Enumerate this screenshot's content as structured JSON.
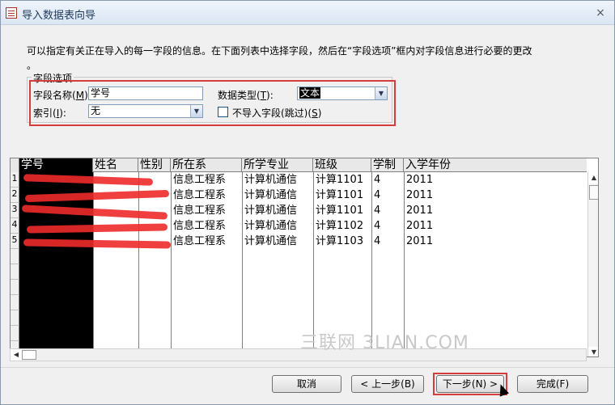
{
  "window": {
    "title": "导入数据表向导",
    "close_glyph": "×"
  },
  "instruction": "可以指定有关正在导入的每一字段的信息。在下面列表中选择字段，然后在“字段选项”框内对字段信息进行必要的更改\n。",
  "field_options": {
    "legend": "字段选项",
    "field_name_label": "字段名称",
    "field_name_key": "M",
    "field_name_value": "学号",
    "data_type_label": "数据类型",
    "data_type_key": "T",
    "data_type_value": "文本",
    "index_label": "索引",
    "index_key": "I",
    "index_value": "无",
    "skip_label": "不导入字段(跳过)",
    "skip_key": "S"
  },
  "table": {
    "columns": [
      "学号",
      "姓名",
      "性别",
      "所在系",
      "所学专业",
      "班级",
      "学制",
      "入学年份"
    ],
    "row_numbers": [
      "1",
      "2",
      "3",
      "4",
      "5"
    ],
    "rows": [
      [
        "",
        "",
        "",
        "信息工程系",
        "计算机通信",
        "计算1101",
        "4",
        "2011"
      ],
      [
        "",
        "",
        "",
        "信息工程系",
        "计算机通信",
        "计算1101",
        "4",
        "2011"
      ],
      [
        "",
        "",
        "",
        "信息工程系",
        "计算机通信",
        "计算1101",
        "4",
        "2011"
      ],
      [
        "",
        "",
        "",
        "信息工程系",
        "计算机通信",
        "计算1102",
        "4",
        "2011"
      ],
      [
        "",
        "",
        "",
        "信息工程系",
        "计算机通信",
        "计算1103",
        "4",
        "2011"
      ]
    ]
  },
  "watermark": "三联网 3LIAN.COM",
  "buttons": {
    "cancel": "取消",
    "back": "< 上一步(B)",
    "next": "下一步(N) >",
    "finish": "完成(F)"
  },
  "colors": {
    "annotation_red": "#d63c3c",
    "scribble_red": "#ee2a2a"
  }
}
